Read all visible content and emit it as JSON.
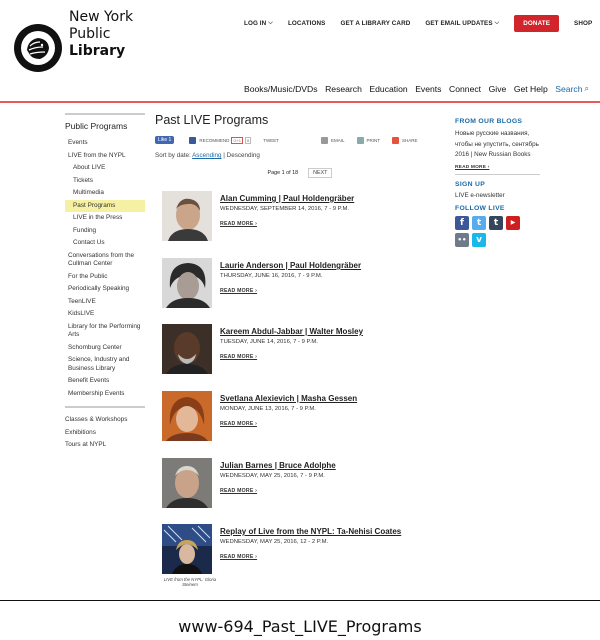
{
  "brand": {
    "line1": "New York",
    "line2": "Public",
    "line3": "Library"
  },
  "topnav": {
    "login": "LOG IN",
    "locations": "LOCATIONS",
    "library_card": "GET A LIBRARY CARD",
    "email_updates": "GET EMAIL UPDATES",
    "donate": "DONATE",
    "shop": "SHOP"
  },
  "mainnav": [
    {
      "label": "Books/Music/DVDs"
    },
    {
      "label": "Research"
    },
    {
      "label": "Education"
    },
    {
      "label": "Events"
    },
    {
      "label": "Connect"
    },
    {
      "label": "Give"
    },
    {
      "label": "Get Help"
    },
    {
      "label": "Search"
    }
  ],
  "sidebar": {
    "heading": "Public Programs",
    "items": [
      {
        "label": "Events"
      },
      {
        "label": "LIVE from the NYPL"
      },
      {
        "label": "About LIVE"
      },
      {
        "label": "Tickets"
      },
      {
        "label": "Multimedia"
      },
      {
        "label": "Past Programs"
      },
      {
        "label": "LIVE in the Press"
      },
      {
        "label": "Funding"
      },
      {
        "label": "Contact Us"
      },
      {
        "label": "Conversations from the Cullman Center"
      },
      {
        "label": "For the Public"
      },
      {
        "label": "Periodically Speaking"
      },
      {
        "label": "TeenLIVE"
      },
      {
        "label": "KidsLIVE"
      },
      {
        "label": "Library for the Performing Arts"
      },
      {
        "label": "Schomburg Center"
      },
      {
        "label": "Science, Industry and Business Library"
      },
      {
        "label": "Benefit Events"
      },
      {
        "label": "Membership Events"
      }
    ],
    "items2": [
      {
        "label": "Classes & Workshops"
      },
      {
        "label": "Exhibitions"
      },
      {
        "label": "Tours at NYPL"
      }
    ]
  },
  "main": {
    "title": "Past LIVE Programs",
    "share": {
      "like": "Like 1",
      "recommend": "RECOMMEND",
      "gplus": "G+1",
      "gcount": "0",
      "tweet": "TWEET",
      "email": "EMAIL",
      "print": "PRINT",
      "share": "SHARE"
    },
    "sort_label": "Sort by date:",
    "sort_asc": "Ascending",
    "sort_sep": "|",
    "sort_desc": "Descending",
    "page_info": "Page 1 of 18",
    "next": "NEXT",
    "read_more": "READ MORE ›",
    "events": [
      {
        "title": "Alan Cumming | Paul Holdengräber",
        "date": "WEDNESDAY, SEPTEMBER 14, 2016, 7 - 9 P.M."
      },
      {
        "title": "Laurie Anderson | Paul Holdengräber",
        "date": "THURSDAY, JUNE 16, 2016, 7 - 9 P.M."
      },
      {
        "title": "Kareem Abdul-Jabbar | Walter Mosley",
        "date": "TUESDAY, JUNE 14, 2016, 7 - 9 P.M."
      },
      {
        "title": "Svetlana Alexievich | Masha Gessen",
        "date": "MONDAY, JUNE 13, 2016, 7 - 9 P.M."
      },
      {
        "title": "Julian Barnes | Bruce Adolphe",
        "date": "WEDNESDAY, MAY 25, 2016, 7 - 9 P.M."
      },
      {
        "title": "Replay of Live from the NYPL: Ta-Nehisi Coates",
        "date": "WEDNESDAY, MAY 25, 2016, 12 - 2 P.M.",
        "caption": "LIVE from the NYPL: Gloria Steinem"
      }
    ]
  },
  "right": {
    "blogs_heading": "FROM OUR BLOGS",
    "blog_text": "Новые русские названия, чтобы не упустить, сентябрь 2016 | New Russian Books",
    "read_more": "READ MORE ›",
    "signup_heading": "SIGN UP",
    "enews": "LIVE e-newsletter",
    "follow_heading": "FOLLOW LIVE",
    "socials": [
      {
        "icon": "facebook-icon",
        "glyph": "f",
        "color": "#3b5998"
      },
      {
        "icon": "twitter-icon",
        "glyph": "t",
        "color": "#55acee"
      },
      {
        "icon": "tumblr-icon",
        "glyph": "t",
        "color": "#35465c"
      },
      {
        "icon": "youtube-icon",
        "glyph": "▶",
        "color": "#cd201f"
      },
      {
        "icon": "flickr-icon",
        "glyph": "••",
        "color": "#6f7b8a"
      },
      {
        "icon": "vimeo-icon",
        "glyph": "v",
        "color": "#1ab7ea"
      }
    ]
  },
  "footer_caption": "www-694_Past_LIVE_Programs",
  "colors": {
    "accent": "#1b6aa8",
    "donate": "#d0252b",
    "divider": "#e8595a",
    "active_bg": "#f6f0a2"
  }
}
